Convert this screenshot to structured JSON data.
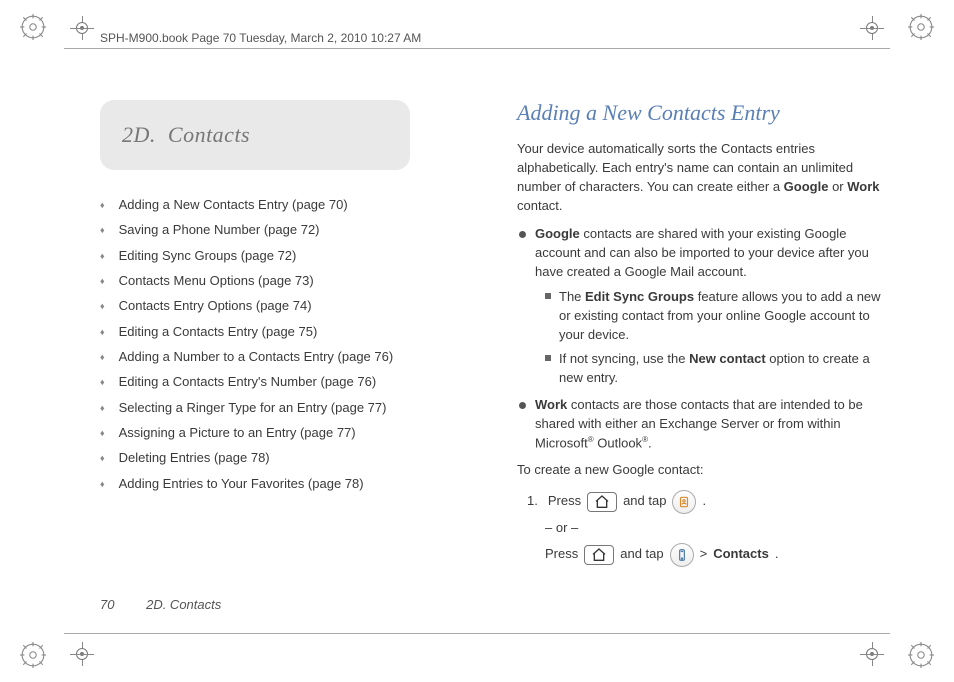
{
  "header": {
    "running_head": "SPH-M900.book  Page 70  Tuesday, March 2, 2010  10:27 AM"
  },
  "section": {
    "number_label": "2D.",
    "title": "Contacts"
  },
  "toc": [
    "Adding a New Contacts Entry (page 70)",
    "Saving a Phone Number (page 72)",
    "Editing Sync Groups (page 72)",
    "Contacts Menu Options (page 73)",
    "Contacts Entry Options (page 74)",
    "Editing a Contacts Entry (page 75)",
    "Adding a Number to a Contacts Entry (page 76)",
    "Editing a Contacts Entry's Number (page 76)",
    "Selecting a Ringer Type for an Entry (page 77)",
    "Assigning a Picture to an Entry (page 77)",
    "Deleting Entries (page 78)",
    "Adding Entries to Your Favorites (page 78)"
  ],
  "right": {
    "heading": "Adding a New Contacts Entry",
    "intro_1": "Your device automatically sorts the Contacts entries alphabetically. Each entry's name can contain an unlimited number of characters. You can create either a ",
    "intro_google": "Google",
    "intro_or": " or ",
    "intro_work": "Work",
    "intro_end": " contact.",
    "b1_lead": "Google",
    "b1_rest": " contacts are shared with your existing Google account and can also be imported to your device after you have created a Google Mail account.",
    "b1a_pre": "The ",
    "b1a_bold": "Edit Sync Groups",
    "b1a_rest": " feature allows you to add a new or existing contact from your online Google account to your device.",
    "b1b_pre": "If not syncing, use the ",
    "b1b_bold": "New contact",
    "b1b_rest": " option to create a new entry.",
    "b2_lead": "Work",
    "b2_rest": " contacts are those contacts that are intended to be shared with either an Exchange Server or from within Microsoft",
    "b2_reg1": "®",
    "b2_outlook": " Outlook",
    "b2_reg2": "®",
    "b2_period": ".",
    "create_label": "To create a new Google contact:",
    "step1_press": "Press ",
    "step1_andtap": " and tap ",
    "step1_dot": " .",
    "step_or": "– or –",
    "step2_press": "Press ",
    "step2_andtap": " and tap ",
    "step2_gt": " > ",
    "step2_contacts": "Contacts",
    "step2_dot": "."
  },
  "footer": {
    "page_number": "70",
    "section_label": "2D. Contacts"
  }
}
